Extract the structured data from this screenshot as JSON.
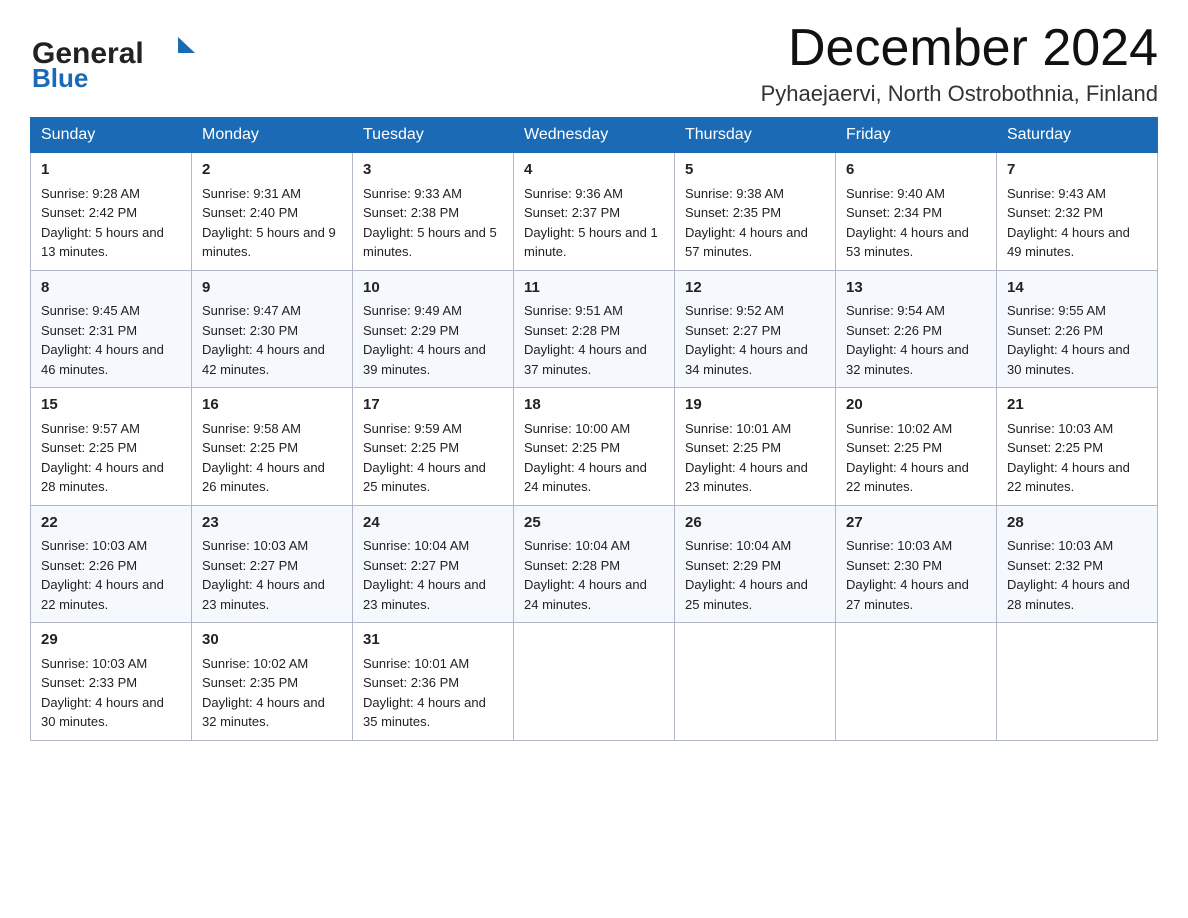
{
  "header": {
    "logo_general": "General",
    "logo_blue": "Blue",
    "month_title": "December 2024",
    "location": "Pyhaejaervi, North Ostrobothnia, Finland"
  },
  "weekdays": [
    "Sunday",
    "Monday",
    "Tuesday",
    "Wednesday",
    "Thursday",
    "Friday",
    "Saturday"
  ],
  "weeks": [
    [
      {
        "day": "1",
        "sunrise": "9:28 AM",
        "sunset": "2:42 PM",
        "daylight": "5 hours and 13 minutes."
      },
      {
        "day": "2",
        "sunrise": "9:31 AM",
        "sunset": "2:40 PM",
        "daylight": "5 hours and 9 minutes."
      },
      {
        "day": "3",
        "sunrise": "9:33 AM",
        "sunset": "2:38 PM",
        "daylight": "5 hours and 5 minutes."
      },
      {
        "day": "4",
        "sunrise": "9:36 AM",
        "sunset": "2:37 PM",
        "daylight": "5 hours and 1 minute."
      },
      {
        "day": "5",
        "sunrise": "9:38 AM",
        "sunset": "2:35 PM",
        "daylight": "4 hours and 57 minutes."
      },
      {
        "day": "6",
        "sunrise": "9:40 AM",
        "sunset": "2:34 PM",
        "daylight": "4 hours and 53 minutes."
      },
      {
        "day": "7",
        "sunrise": "9:43 AM",
        "sunset": "2:32 PM",
        "daylight": "4 hours and 49 minutes."
      }
    ],
    [
      {
        "day": "8",
        "sunrise": "9:45 AM",
        "sunset": "2:31 PM",
        "daylight": "4 hours and 46 minutes."
      },
      {
        "day": "9",
        "sunrise": "9:47 AM",
        "sunset": "2:30 PM",
        "daylight": "4 hours and 42 minutes."
      },
      {
        "day": "10",
        "sunrise": "9:49 AM",
        "sunset": "2:29 PM",
        "daylight": "4 hours and 39 minutes."
      },
      {
        "day": "11",
        "sunrise": "9:51 AM",
        "sunset": "2:28 PM",
        "daylight": "4 hours and 37 minutes."
      },
      {
        "day": "12",
        "sunrise": "9:52 AM",
        "sunset": "2:27 PM",
        "daylight": "4 hours and 34 minutes."
      },
      {
        "day": "13",
        "sunrise": "9:54 AM",
        "sunset": "2:26 PM",
        "daylight": "4 hours and 32 minutes."
      },
      {
        "day": "14",
        "sunrise": "9:55 AM",
        "sunset": "2:26 PM",
        "daylight": "4 hours and 30 minutes."
      }
    ],
    [
      {
        "day": "15",
        "sunrise": "9:57 AM",
        "sunset": "2:25 PM",
        "daylight": "4 hours and 28 minutes."
      },
      {
        "day": "16",
        "sunrise": "9:58 AM",
        "sunset": "2:25 PM",
        "daylight": "4 hours and 26 minutes."
      },
      {
        "day": "17",
        "sunrise": "9:59 AM",
        "sunset": "2:25 PM",
        "daylight": "4 hours and 25 minutes."
      },
      {
        "day": "18",
        "sunrise": "10:00 AM",
        "sunset": "2:25 PM",
        "daylight": "4 hours and 24 minutes."
      },
      {
        "day": "19",
        "sunrise": "10:01 AM",
        "sunset": "2:25 PM",
        "daylight": "4 hours and 23 minutes."
      },
      {
        "day": "20",
        "sunrise": "10:02 AM",
        "sunset": "2:25 PM",
        "daylight": "4 hours and 22 minutes."
      },
      {
        "day": "21",
        "sunrise": "10:03 AM",
        "sunset": "2:25 PM",
        "daylight": "4 hours and 22 minutes."
      }
    ],
    [
      {
        "day": "22",
        "sunrise": "10:03 AM",
        "sunset": "2:26 PM",
        "daylight": "4 hours and 22 minutes."
      },
      {
        "day": "23",
        "sunrise": "10:03 AM",
        "sunset": "2:27 PM",
        "daylight": "4 hours and 23 minutes."
      },
      {
        "day": "24",
        "sunrise": "10:04 AM",
        "sunset": "2:27 PM",
        "daylight": "4 hours and 23 minutes."
      },
      {
        "day": "25",
        "sunrise": "10:04 AM",
        "sunset": "2:28 PM",
        "daylight": "4 hours and 24 minutes."
      },
      {
        "day": "26",
        "sunrise": "10:04 AM",
        "sunset": "2:29 PM",
        "daylight": "4 hours and 25 minutes."
      },
      {
        "day": "27",
        "sunrise": "10:03 AM",
        "sunset": "2:30 PM",
        "daylight": "4 hours and 27 minutes."
      },
      {
        "day": "28",
        "sunrise": "10:03 AM",
        "sunset": "2:32 PM",
        "daylight": "4 hours and 28 minutes."
      }
    ],
    [
      {
        "day": "29",
        "sunrise": "10:03 AM",
        "sunset": "2:33 PM",
        "daylight": "4 hours and 30 minutes."
      },
      {
        "day": "30",
        "sunrise": "10:02 AM",
        "sunset": "2:35 PM",
        "daylight": "4 hours and 32 minutes."
      },
      {
        "day": "31",
        "sunrise": "10:01 AM",
        "sunset": "2:36 PM",
        "daylight": "4 hours and 35 minutes."
      },
      null,
      null,
      null,
      null
    ]
  ],
  "labels": {
    "sunrise": "Sunrise:",
    "sunset": "Sunset:",
    "daylight": "Daylight:"
  }
}
